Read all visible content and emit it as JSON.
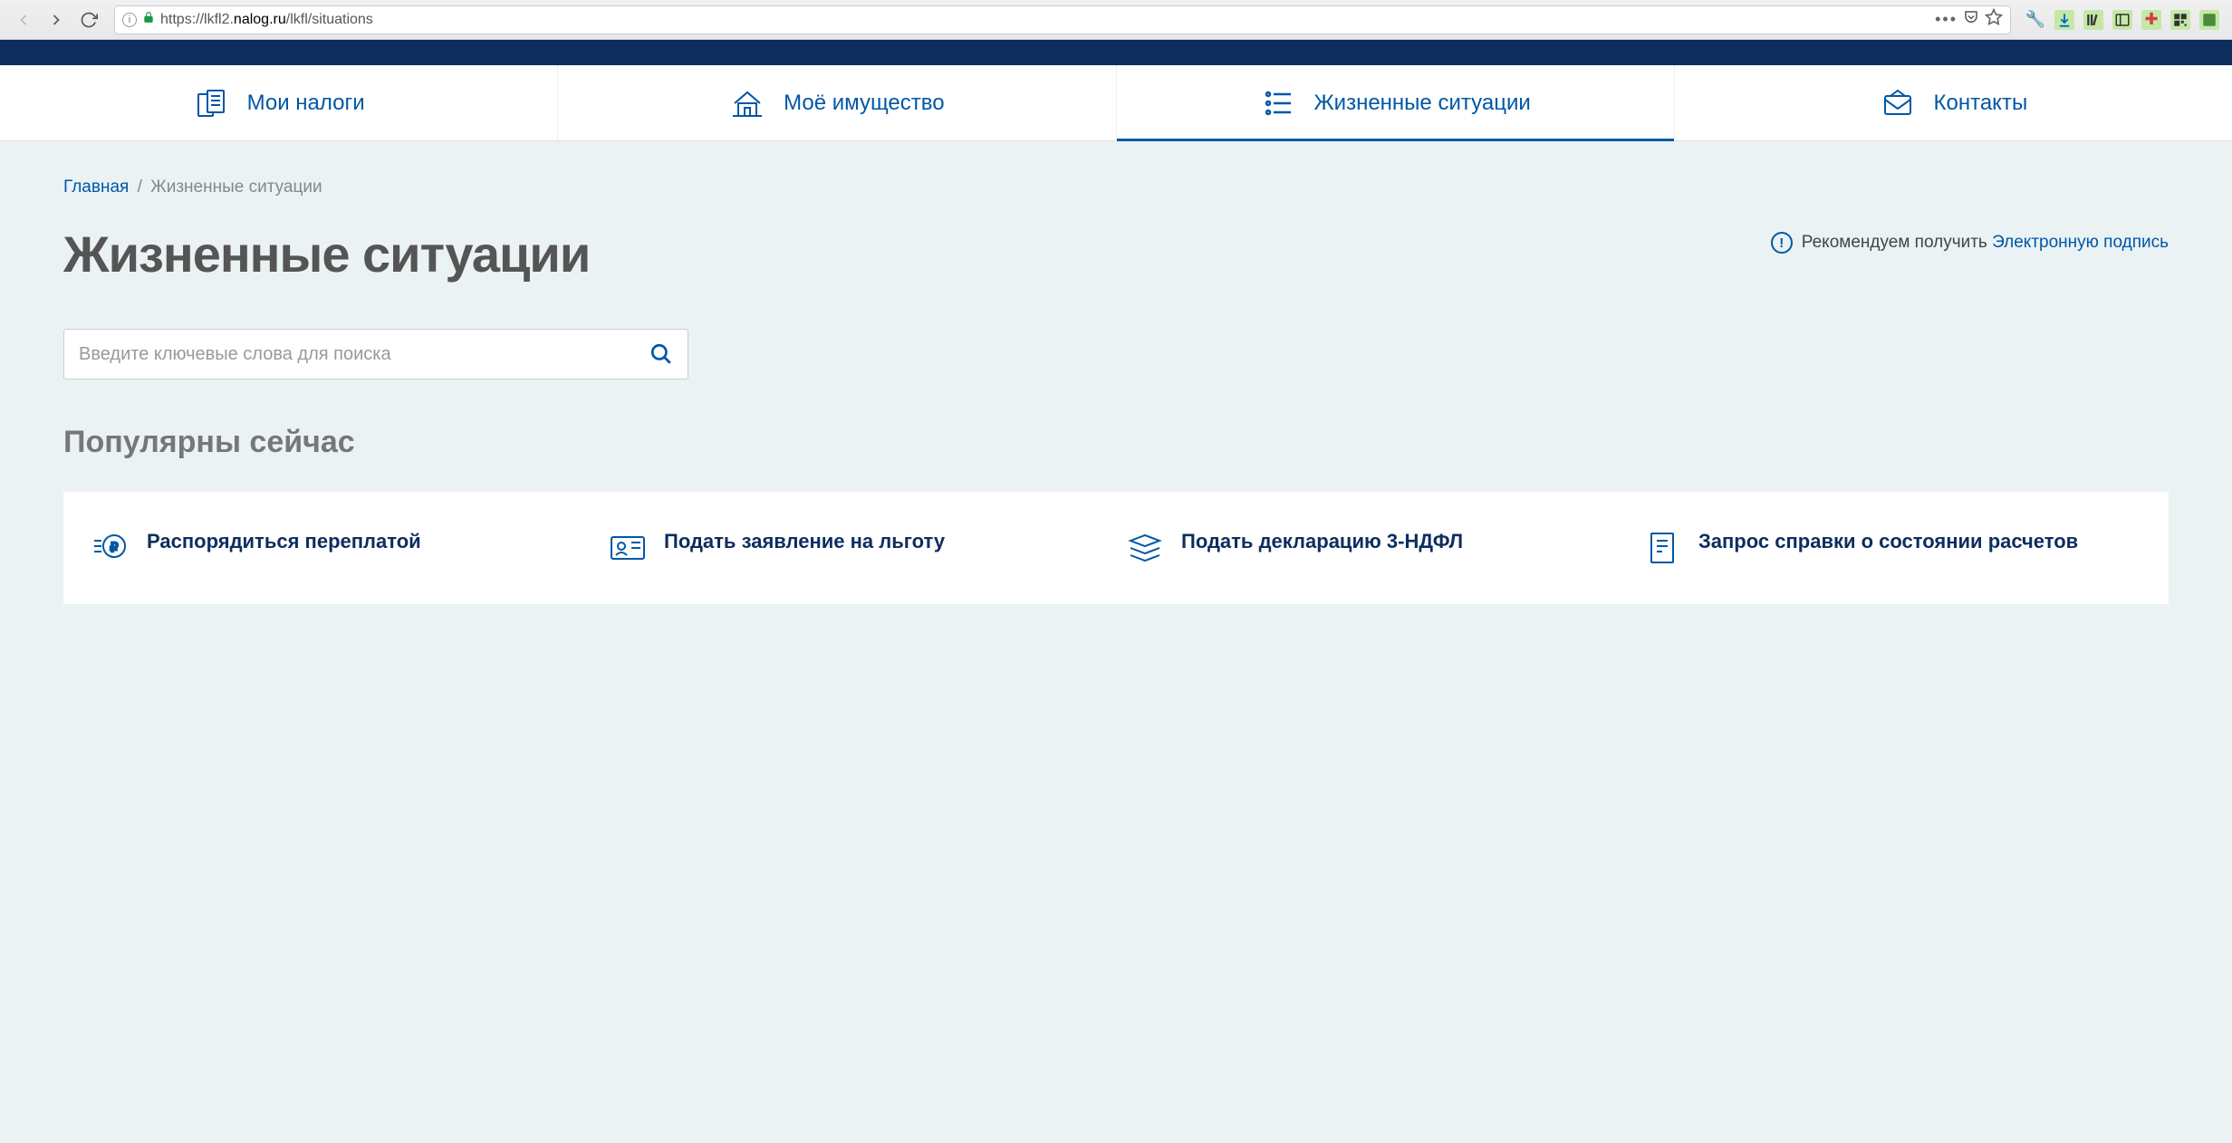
{
  "browser": {
    "url_prefix": "https://lkfl2.",
    "url_host": "nalog.ru",
    "url_path": "/lkfl/situations"
  },
  "nav": {
    "tabs": [
      {
        "label": "Мои налоги"
      },
      {
        "label": "Моё имущество"
      },
      {
        "label": "Жизненные ситуации"
      },
      {
        "label": "Контакты"
      }
    ]
  },
  "breadcrumb": {
    "home": "Главная",
    "current": "Жизненные ситуации"
  },
  "page_title": "Жизненные ситуации",
  "notice": {
    "text": "Рекомендуем получить ",
    "link": "Электронную подпись"
  },
  "search": {
    "placeholder": "Введите ключевые слова для поиска"
  },
  "section_title": "Популярны сейчас",
  "cards": [
    {
      "title": "Распорядиться переплатой"
    },
    {
      "title": "Подать заявление на льготу"
    },
    {
      "title": "Подать декларацию 3-НДФЛ"
    },
    {
      "title": "Запрос справки о состоянии расчетов"
    }
  ]
}
